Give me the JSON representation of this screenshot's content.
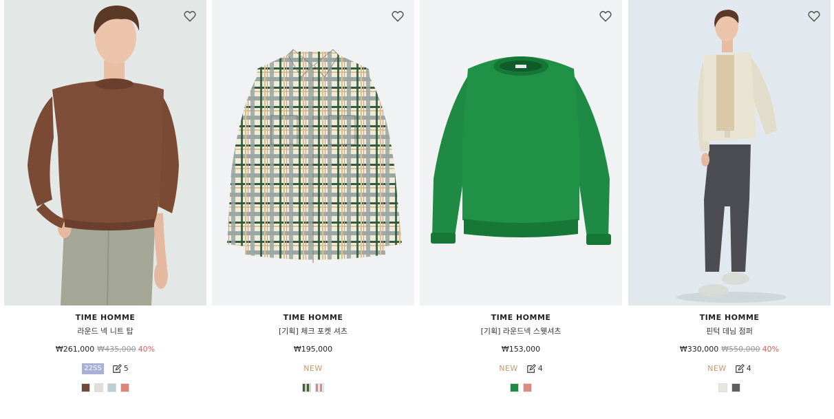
{
  "products": [
    {
      "brand": "TIME HOMME",
      "name": "라운드 넥 니트 탑",
      "price": "₩261,000",
      "original_price": "₩435,000",
      "discount": "40%",
      "season_badge": "22SS",
      "review_count": "5",
      "image": "model-brown-knit",
      "swatches": [
        "#6b4a3a",
        "#e0dedb",
        "#b9cfd2",
        "#d98677"
      ]
    },
    {
      "brand": "TIME HOMME",
      "name": "[기획] 체크 포켓 셔츠",
      "price": "₩195,000",
      "new_label": "NEW",
      "image": "check-pocket-shirt",
      "swatches": [
        "check-green",
        "check-pink"
      ]
    },
    {
      "brand": "TIME HOMME",
      "name": "[기획] 라운드넥 스웻셔츠",
      "price": "₩153,000",
      "new_label": "NEW",
      "review_count": "4",
      "image": "green-sweatshirt",
      "swatches": [
        "#1f8a45",
        "#db8a7f"
      ]
    },
    {
      "brand": "TIME HOMME",
      "name": "핀턱 데님 점퍼",
      "price": "₩330,000",
      "original_price": "₩550,000",
      "discount": "40%",
      "new_label": "NEW",
      "review_count": "4",
      "image": "model-denim-jacket",
      "swatches": [
        "#e8e6e0",
        "#5e5f60"
      ]
    }
  ],
  "icons": {
    "wishlist": "heart-outline-icon",
    "review": "pencil-square-icon"
  },
  "colors": {
    "discount": "#e05a5a",
    "new": "#c9966a",
    "season_badge": "#a9b0d6"
  }
}
